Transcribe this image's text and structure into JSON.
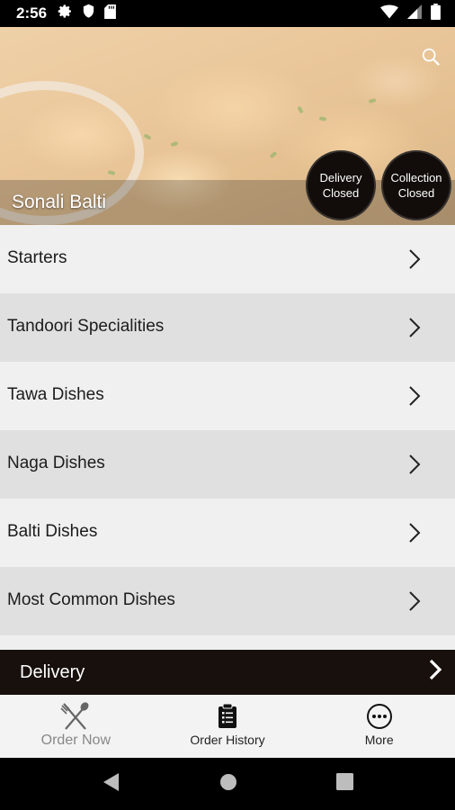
{
  "status_bar": {
    "time": "2:56",
    "left_icons": [
      "gear-icon",
      "shield-icon",
      "sd-card-icon"
    ],
    "right_icons": [
      "wifi-icon",
      "signal-icon",
      "battery-icon"
    ]
  },
  "header": {
    "restaurant_name": "Sonali Balti",
    "delivery_status": "Delivery Closed",
    "collection_status": "Collection Closed",
    "search_icon": "search-icon"
  },
  "menu": {
    "categories": [
      {
        "label": "Starters"
      },
      {
        "label": "Tandoori Specialities"
      },
      {
        "label": "Tawa Dishes"
      },
      {
        "label": "Naga Dishes"
      },
      {
        "label": "Balti Dishes"
      },
      {
        "label": "Most Common Dishes"
      }
    ]
  },
  "order_mode": {
    "label": "Delivery"
  },
  "bottom_nav": {
    "items": [
      {
        "label": "Order Now",
        "icon": "fork-spoon-icon",
        "active": true
      },
      {
        "label": "Order History",
        "icon": "clipboard-icon",
        "active": false
      },
      {
        "label": "More",
        "icon": "more-icon",
        "active": false
      }
    ]
  },
  "colors": {
    "dark_bar": "#17100c",
    "badge_bg": "#120d0a",
    "list_light": "#f0f0f0",
    "list_dark": "#e0e0e0"
  }
}
